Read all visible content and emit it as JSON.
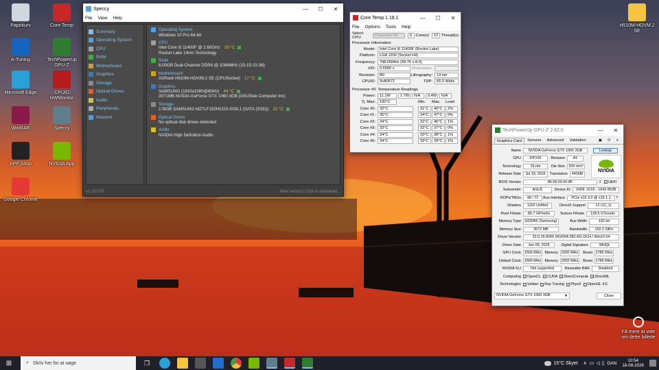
{
  "desktop": {
    "icons_left": [
      {
        "label": "Papirkurv",
        "color": "#cfd8dc"
      },
      {
        "label": "A-Tuning",
        "color": "#1565c0"
      },
      {
        "label": "Microsoft Edge",
        "color": "#2aa0d8"
      },
      {
        "label": "WinRAR",
        "color": "#8b1a4a"
      },
      {
        "label": "APP Shop",
        "color": "#222"
      },
      {
        "label": "Google Chrome",
        "color": "#e53935"
      }
    ],
    "icons_col2": [
      {
        "label": "Core Temp",
        "color": "#c62828"
      },
      {
        "label": "TechPowerUp GPU-Z",
        "color": "#2e7d32"
      },
      {
        "label": "CPUID HWMonitor",
        "color": "#b71c1c"
      },
      {
        "label": "Speccy",
        "color": "#607d8b"
      },
      {
        "label": "NVIDIA App",
        "color": "#76b900"
      }
    ],
    "icons_right": [
      {
        "label": "H510M-HDVM.2 SE",
        "color": "#f5c542"
      }
    ],
    "bing_text": "Få mere at vide om dette billede"
  },
  "speccy": {
    "title": "Speccy",
    "menu": [
      "File",
      "View",
      "Help"
    ],
    "nav": [
      {
        "label": "Summary",
        "color": "#7ec3f0"
      },
      {
        "label": "Operating System",
        "color": "#4fa3e0"
      },
      {
        "label": "CPU",
        "color": "#a0a0a0"
      },
      {
        "label": "RAM",
        "color": "#3cb043"
      },
      {
        "label": "Motherboard",
        "color": "#c9a227"
      },
      {
        "label": "Graphics",
        "color": "#3b78c2"
      },
      {
        "label": "Storage",
        "color": "#8a8a8a"
      },
      {
        "label": "Optical Drives",
        "color": "#e0612b"
      },
      {
        "label": "Audio",
        "color": "#d6c23a"
      },
      {
        "label": "Peripherals",
        "color": "#aaaaaa"
      },
      {
        "label": "Network",
        "color": "#4aa0d8"
      }
    ],
    "sections": [
      {
        "head": "Operating System",
        "color": "#4fa3e0",
        "lines": [
          "Windows 10 Pro 64-bit"
        ],
        "temp": ""
      },
      {
        "head": "CPU",
        "color": "#a0a0a0",
        "lines": [
          "Intel Core i5 11400F @ 2.60GHz",
          "Rocket Lake 14nm Technology"
        ],
        "temp": "33 °C"
      },
      {
        "head": "RAM",
        "color": "#3cb043",
        "lines": [
          "8,00GB Dual-Channel DDR4 @ 1064MHz (15-15-15-36)"
        ],
        "temp": ""
      },
      {
        "head": "Motherboard",
        "color": "#c9a227",
        "lines": [
          "ASRock H510M-HDV/M.2 SE (CPUSocket)"
        ],
        "temp": "17 °C"
      },
      {
        "head": "Graphics",
        "color": "#3b78c2",
        "lines": [
          "SAMSUNG (1920x1080@60Hz)",
          "3071MB NVIDIA GeForce GTX 1060 3GB (ASUStek Computer Inc)"
        ],
        "temp": "44 °C"
      },
      {
        "head": "Storage",
        "color": "#8a8a8a",
        "lines": [
          "178GB SAMSUNG MZ7LF192HCGS-000L1 (SATA (SSD))"
        ],
        "temp": "32 °C"
      },
      {
        "head": "Optical Drives",
        "color": "#e0612b",
        "lines": [
          "No optical disk drives detected"
        ],
        "temp": ""
      },
      {
        "head": "Audio",
        "color": "#d6c23a",
        "lines": [
          "NVIDIA High Definition Audio"
        ],
        "temp": ""
      }
    ],
    "version": "v1.33.075",
    "update": "New version! Click to download..."
  },
  "coretemp": {
    "title": "Core Temp 1.18.1",
    "menu": [
      "File",
      "Options",
      "Tools",
      "Help"
    ],
    "select_cpu_label": "Select CPU:",
    "select_cpu_value": "Processor #0",
    "cores_num": "6",
    "cores_label": "Core(s)",
    "threads_num": "12",
    "threads_label": "Thread(s)",
    "info_title": "Processor Information",
    "model_label": "Model:",
    "model": "Intel Core i5 11400F (Rocket Lake)",
    "platform_label": "Platform:",
    "platform": "LGA 1200 (Socket H4)",
    "frequency_label": "Frequency:",
    "frequency": "798.05MHz (99.76 x 8.0)",
    "vid_label": "VID:",
    "vid": "0.6680 v",
    "modulation_label": "Modulation:",
    "revision_label": "Revision:",
    "revision": "B0",
    "lithography_label": "Lithography:",
    "lithography": "14 nm",
    "cpuid_label": "CPUID:",
    "cpuid": "0xA0671",
    "tdp_label": "TDP:",
    "tdp": "65.0 Watts",
    "temps_title": "Processor #0: Temperature Readings",
    "power_label": "Power:",
    "power": [
      "11.1W",
      "1.7W",
      "N/A",
      "9.4W",
      "N/A"
    ],
    "tjmax_label": "Tj. Max:",
    "tjmax": "100°C",
    "headers": [
      "Min.",
      "Max.",
      "Load"
    ],
    "cores": [
      {
        "name": "Core #0:",
        "temp": "32°C",
        "min": "31°C",
        "max": "40°C",
        "load": "2%"
      },
      {
        "name": "Core #1:",
        "temp": "35°C",
        "min": "34°C",
        "max": "47°C",
        "load": "0%"
      },
      {
        "name": "Core #2:",
        "temp": "34°C",
        "min": "32°C",
        "max": "46°C",
        "load": "1%"
      },
      {
        "name": "Core #3:",
        "temp": "33°C",
        "min": "32°C",
        "max": "37°C",
        "load": "0%"
      },
      {
        "name": "Core #4:",
        "temp": "34°C",
        "min": "33°C",
        "max": "38°C",
        "load": "1%"
      },
      {
        "name": "Core #5:",
        "temp": "34°C",
        "min": "33°C",
        "max": "39°C",
        "load": "1%"
      }
    ]
  },
  "gpuz": {
    "title": "TechPowerUp GPU-Z 2.62.0",
    "tabs": [
      "Graphics Card",
      "Sensors",
      "Advanced",
      "Validation"
    ],
    "name_label": "Name",
    "name": "NVIDIA GeForce GTX 1060 3GB",
    "lookup": "Lookup",
    "gpu_label": "GPU",
    "gpu": "GP106",
    "revision_label": "Revision",
    "revision": "A1",
    "tech_label": "Technology",
    "tech": "16 nm",
    "die_label": "Die Size",
    "die": "200 mm²",
    "release_label": "Release Date",
    "release": "Jul 19, 2016",
    "trans_label": "Transistors",
    "trans": "4400M",
    "bios_label": "BIOS Version",
    "bios": "86.06.59.00.8F",
    "uefi": "UEFI",
    "subvendor_label": "Subvendor",
    "subvendor": "ASUS",
    "device_label": "Device ID",
    "device": "10DE 1C02 - 1043 863B",
    "rops_label": "ROPs/TMUs",
    "rops": "48 / 72",
    "bus_label": "Bus Interface",
    "bus": "PCIe x16 3.0 @ x16 1.1",
    "shaders_label": "Shaders",
    "shaders": "1152 Unified",
    "dx_label": "DirectX Support",
    "dx": "12 (12_1)",
    "pixel_label": "Pixel Fillrate",
    "pixel": "85.7 GPixel/s",
    "texture_label": "Texture Fillrate",
    "texture": "128.5 GTexel/s",
    "memtype_label": "Memory Type",
    "memtype": "GDDR5 (Samsung)",
    "buswidth_label": "Bus Width",
    "buswidth": "192 bit",
    "memsize_label": "Memory Size",
    "memsize": "3072 MB",
    "bandwidth_label": "Bandwidth",
    "bandwidth": "192.2 GB/s",
    "driver_label": "Driver Version",
    "driver": "32.0.15.8266 (NVIDIA 582.66) DCH / Win10 64",
    "driverdate_label": "Driver Date",
    "driverdate": "Jun 09, 2026",
    "sig_label": "Digital Signature",
    "sig": "WHQL",
    "gpuclock_label": "GPU Clock",
    "gpuclock": "1569 MHz",
    "mem_label": "Memory",
    "memclock": "2002 MHz",
    "boost_label": "Boost",
    "boost": "1785 MHz",
    "defclock_label": "Default Clock",
    "defclock": "1569 MHz",
    "defmem": "2002 MHz",
    "defboost": "1785 MHz",
    "sli_label": "NVIDIA SLI",
    "sli": "Not supported",
    "rebar_label": "Resizable BAR",
    "rebar": "Disabled",
    "computing_label": "Computing",
    "computing": [
      "OpenCL",
      "CUDA",
      "DirectCompute",
      "DirectML"
    ],
    "technologies_label": "Technologies",
    "technologies": [
      "Vulkan",
      "Ray Tracing",
      "PhysX",
      "OpenGL 4.6"
    ],
    "select": "NVIDIA GeForce GTX 1060 3GB",
    "close": "Close",
    "logo": "NVIDIA"
  },
  "taskbar": {
    "search_placeholder": "Skriv her for at søge",
    "weather": "15°C  Skyet",
    "lang": "DAN",
    "time": "10:54",
    "date": "18-08-2026"
  }
}
